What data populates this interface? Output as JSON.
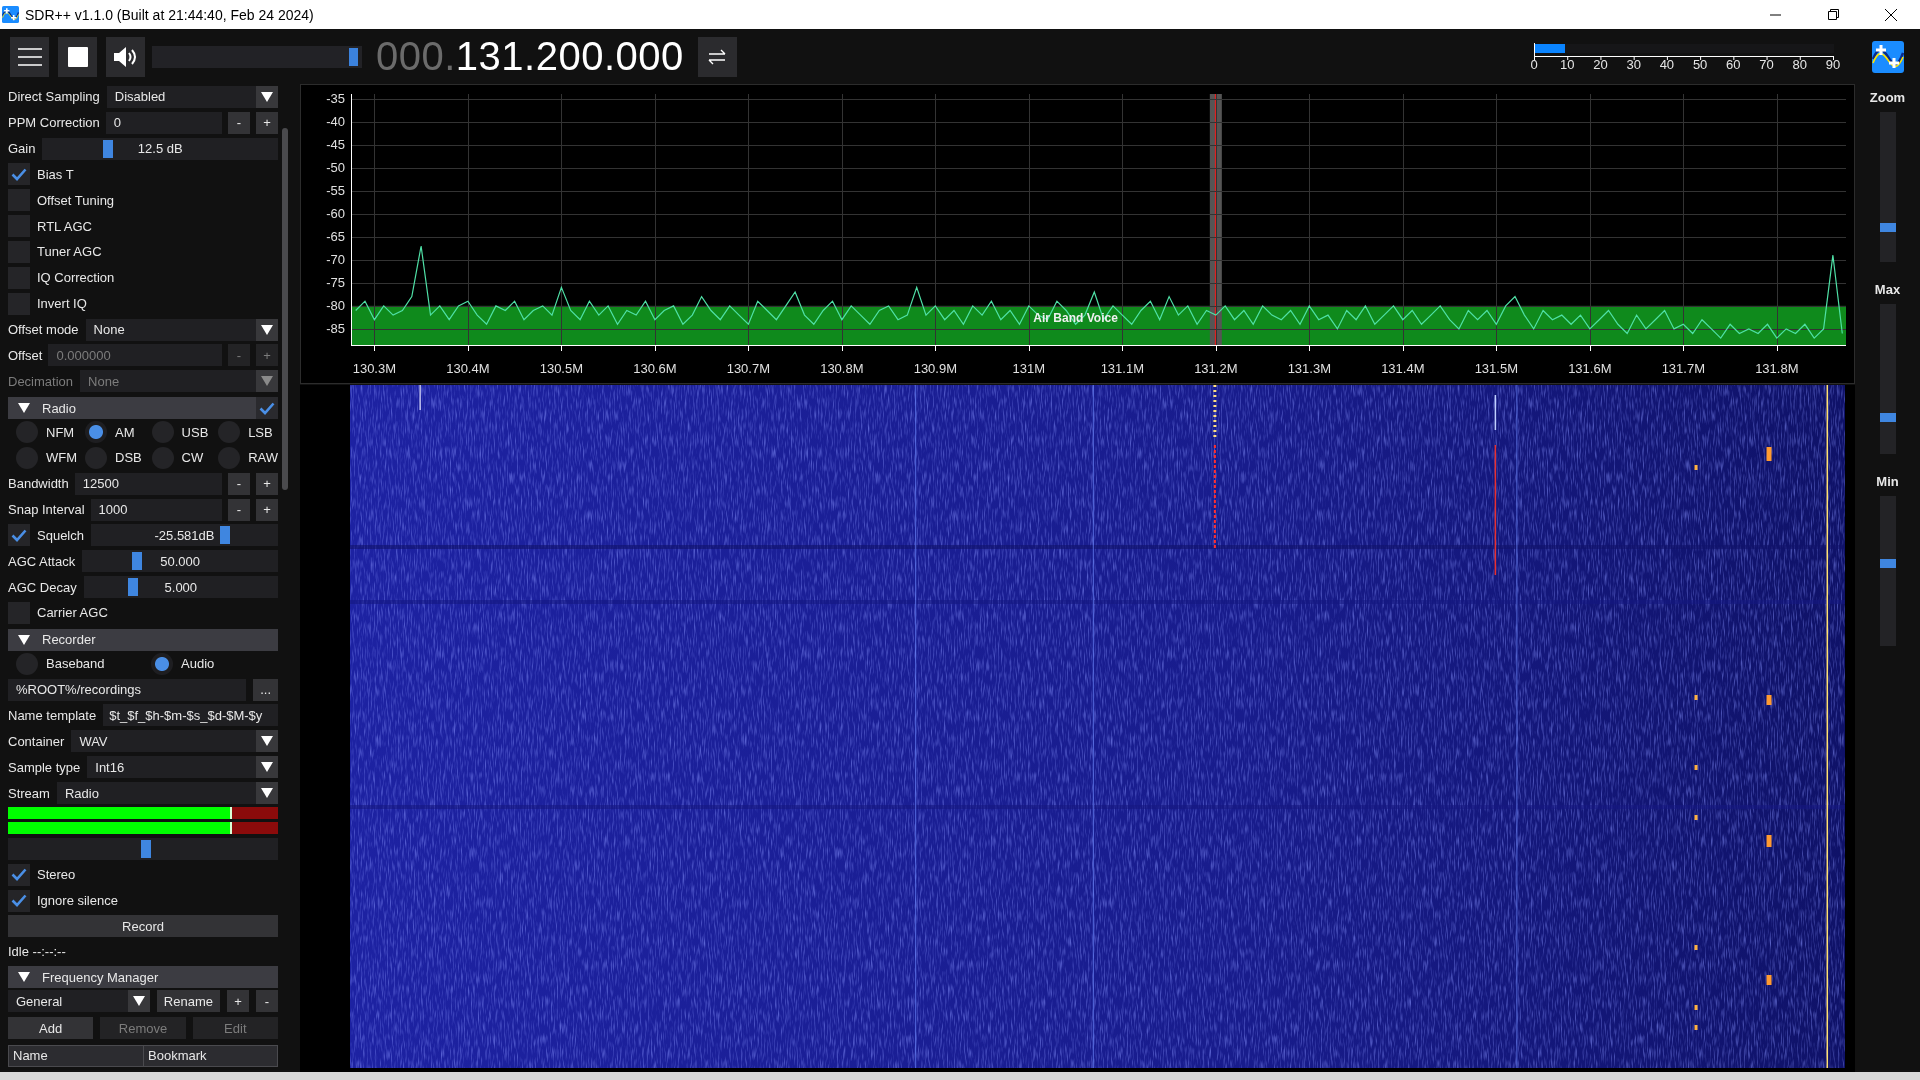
{
  "window": {
    "title": "SDR++ v1.1.0 (Built at 21:44:40, Feb 24 2024)"
  },
  "toolbar": {
    "playing": true,
    "volume": {
      "level": 0.98
    },
    "frequency": {
      "leading": "000.",
      "main": "131.200.000"
    },
    "snr_meter": {
      "level": 0.1,
      "ticks": [
        "0",
        "10",
        "20",
        "30",
        "40",
        "50",
        "60",
        "70",
        "80",
        "90"
      ]
    }
  },
  "sidebar": {
    "rows": [
      {
        "kind": "select",
        "label": "Direct Sampling",
        "value": "Disabled",
        "disabled": false
      },
      {
        "kind": "number",
        "label": "PPM Correction",
        "value": "0",
        "buttons": [
          "-",
          "+"
        ],
        "disabled": false
      },
      {
        "kind": "slider",
        "label": "Gain",
        "value": "12.5 dB",
        "level": 0.27
      },
      {
        "kind": "checkbox",
        "label": "Bias T",
        "checked": true
      },
      {
        "kind": "checkbox",
        "label": "Offset Tuning",
        "checked": false
      },
      {
        "kind": "checkbox",
        "label": "RTL AGC",
        "checked": false
      },
      {
        "kind": "checkbox",
        "label": "Tuner AGC",
        "checked": false
      },
      {
        "kind": "checkbox",
        "label": "IQ Correction",
        "checked": false
      },
      {
        "kind": "checkbox",
        "label": "Invert IQ",
        "checked": false
      },
      {
        "kind": "select",
        "label": "Offset mode",
        "value": "None",
        "disabled": false
      },
      {
        "kind": "number",
        "label": "Offset",
        "value": "0.000000",
        "buttons": [
          "-",
          "+"
        ],
        "disabled": true
      },
      {
        "kind": "select",
        "label": "Decimation",
        "value": "None",
        "disabled": true
      },
      {
        "kind": "header",
        "label": "Radio",
        "expanded": true,
        "checked": true
      },
      {
        "kind": "radios",
        "options": [
          {
            "label": "NFM",
            "selected": false
          },
          {
            "label": "AM",
            "selected": true
          },
          {
            "label": "USB",
            "selected": false
          },
          {
            "label": "LSB",
            "selected": false
          },
          {
            "label": "WFM",
            "selected": false
          },
          {
            "label": "DSB",
            "selected": false
          },
          {
            "label": "CW",
            "selected": false
          },
          {
            "label": "RAW",
            "selected": false
          }
        ]
      },
      {
        "kind": "number",
        "label": "Bandwidth",
        "value": "12500",
        "buttons": [
          "-",
          "+"
        ],
        "disabled": false
      },
      {
        "kind": "number",
        "label": "Snap Interval",
        "value": "1000",
        "buttons": [
          "-",
          "+"
        ],
        "disabled": false
      },
      {
        "kind": "checkbox_slider",
        "label": "Squelch",
        "checked": true,
        "value": "-25.581dB",
        "level": 0.73
      },
      {
        "kind": "slider",
        "label": "AGC Attack",
        "value": "50.000",
        "level": 0.27
      },
      {
        "kind": "slider",
        "label": "AGC Decay",
        "value": "5.000",
        "level": 0.24
      },
      {
        "kind": "checkbox",
        "label": "Carrier AGC",
        "checked": false
      },
      {
        "kind": "header",
        "label": "Recorder",
        "expanded": true
      },
      {
        "kind": "radios",
        "options": [
          {
            "label": "Baseband",
            "selected": false
          },
          {
            "label": "Audio",
            "selected": true
          }
        ]
      },
      {
        "kind": "path",
        "value": "%ROOT%/recordings",
        "button": "..."
      },
      {
        "kind": "text",
        "label": "Name template",
        "value": "$t_$f_$h-$m-$s_$d-$M-$y"
      },
      {
        "kind": "select",
        "label": "Container",
        "value": "WAV",
        "disabled": false
      },
      {
        "kind": "select",
        "label": "Sample type",
        "value": "Int16",
        "disabled": false
      },
      {
        "kind": "select",
        "label": "Stream",
        "value": "Radio",
        "disabled": false
      },
      {
        "kind": "meter",
        "level": 0.83
      },
      {
        "kind": "meter",
        "level": 0.83
      },
      {
        "kind": "slider",
        "level": 0.51
      },
      {
        "kind": "checkbox",
        "label": "Stereo",
        "checked": true
      },
      {
        "kind": "checkbox",
        "label": "Ignore silence",
        "checked": true
      },
      {
        "kind": "button",
        "label": "Record",
        "disabled": false
      },
      {
        "kind": "status",
        "text": "Idle --:--:--"
      },
      {
        "kind": "header",
        "label": "Frequency Manager",
        "expanded": true
      },
      {
        "kind": "combo_row",
        "value": "General",
        "buttons": [
          {
            "label": "Rename"
          },
          {
            "label": "+"
          },
          {
            "label": "-"
          }
        ]
      },
      {
        "kind": "buttons",
        "buttons": [
          {
            "label": "Add",
            "disabled": false
          },
          {
            "label": "Remove",
            "disabled": true
          },
          {
            "label": "Edit",
            "disabled": true
          }
        ]
      },
      {
        "kind": "table",
        "columns": [
          "Name",
          "Bookmark"
        ]
      }
    ]
  },
  "spectrum": {
    "bookmark": {
      "label": "Air Band Voice"
    },
    "chart_data": {
      "type": "line",
      "grid": true,
      "xlim": [
        130.275,
        131.874
      ],
      "ylim": [
        -88.5,
        -34
      ],
      "yticks": [
        -35,
        -40,
        -45,
        -50,
        -55,
        -60,
        -65,
        -70,
        -75,
        -80,
        -85
      ],
      "xticks": [
        {
          "value": 130.3,
          "label": "130.3M"
        },
        {
          "value": 130.4,
          "label": "130.4M"
        },
        {
          "value": 130.5,
          "label": "130.5M"
        },
        {
          "value": 130.6,
          "label": "130.6M"
        },
        {
          "value": 130.7,
          "label": "130.7M"
        },
        {
          "value": 130.8,
          "label": "130.8M"
        },
        {
          "value": 130.9,
          "label": "130.9M"
        },
        {
          "value": 131,
          "label": "131M"
        },
        {
          "value": 131.1,
          "label": "131.1M"
        },
        {
          "value": 131.2,
          "label": "131.2M"
        },
        {
          "value": 131.3,
          "label": "131.3M"
        },
        {
          "value": 131.4,
          "label": "131.4M"
        },
        {
          "value": 131.5,
          "label": "131.5M"
        },
        {
          "value": 131.6,
          "label": "131.6M"
        },
        {
          "value": 131.7,
          "label": "131.7M"
        },
        {
          "value": 131.8,
          "label": "131.8M"
        }
      ],
      "x": [
        130.28,
        130.29,
        130.3,
        130.31,
        130.32,
        130.33,
        130.34,
        130.35,
        130.36,
        130.37,
        130.38,
        130.39,
        130.4,
        130.41,
        130.42,
        130.43,
        130.44,
        130.45,
        130.46,
        130.47,
        130.48,
        130.49,
        130.5,
        130.51,
        130.52,
        130.53,
        130.54,
        130.55,
        130.56,
        130.57,
        130.58,
        130.59,
        130.6,
        130.61,
        130.62,
        130.63,
        130.64,
        130.65,
        130.66,
        130.67,
        130.68,
        130.69,
        130.7,
        130.71,
        130.72,
        130.73,
        130.74,
        130.75,
        130.76,
        130.77,
        130.78,
        130.79,
        130.8,
        130.81,
        130.82,
        130.83,
        130.84,
        130.85,
        130.86,
        130.87,
        130.88,
        130.89,
        130.9,
        130.91,
        130.92,
        130.93,
        130.94,
        130.95,
        130.96,
        130.97,
        130.98,
        130.99,
        131.0,
        131.01,
        131.02,
        131.03,
        131.04,
        131.05,
        131.06,
        131.07,
        131.08,
        131.09,
        131.1,
        131.11,
        131.12,
        131.13,
        131.14,
        131.15,
        131.16,
        131.17,
        131.18,
        131.19,
        131.2,
        131.21,
        131.22,
        131.23,
        131.24,
        131.25,
        131.26,
        131.27,
        131.28,
        131.29,
        131.3,
        131.31,
        131.32,
        131.33,
        131.34,
        131.35,
        131.36,
        131.37,
        131.38,
        131.39,
        131.4,
        131.41,
        131.42,
        131.43,
        131.44,
        131.45,
        131.46,
        131.47,
        131.48,
        131.49,
        131.5,
        131.51,
        131.52,
        131.53,
        131.54,
        131.55,
        131.56,
        131.57,
        131.58,
        131.59,
        131.6,
        131.61,
        131.62,
        131.63,
        131.64,
        131.65,
        131.66,
        131.67,
        131.68,
        131.69,
        131.7,
        131.71,
        131.72,
        131.73,
        131.74,
        131.75,
        131.76,
        131.77,
        131.78,
        131.79,
        131.8,
        131.81,
        131.82,
        131.83,
        131.84,
        131.85,
        131.86,
        131.87
      ],
      "series": [
        {
          "color": "#4fe0a6",
          "values": [
            -81,
            -79,
            -83,
            -80,
            -82,
            -81,
            -78,
            -67,
            -82,
            -80,
            -83,
            -80,
            -79,
            -82,
            -84,
            -80,
            -81,
            -79,
            -83,
            -81,
            -80,
            -82,
            -76,
            -81,
            -83,
            -79,
            -82,
            -80,
            -84,
            -81,
            -82,
            -79,
            -83,
            -81,
            -80,
            -84,
            -82,
            -78,
            -81,
            -83,
            -80,
            -82,
            -84,
            -79,
            -81,
            -83,
            -80,
            -77,
            -82,
            -84,
            -81,
            -79,
            -83,
            -80,
            -82,
            -84,
            -81,
            -80,
            -83,
            -82,
            -76,
            -82,
            -80,
            -83,
            -81,
            -84,
            -80,
            -82,
            -79,
            -83,
            -81,
            -84,
            -80,
            -82,
            -83,
            -79,
            -81,
            -84,
            -82,
            -77,
            -83,
            -80,
            -82,
            -84,
            -81,
            -79,
            -83,
            -78,
            -82,
            -80,
            -84,
            -81,
            -82,
            -80,
            -83,
            -81,
            -84,
            -80,
            -82,
            -83,
            -81,
            -84,
            -80,
            -83,
            -82,
            -85,
            -81,
            -83,
            -80,
            -84,
            -82,
            -80,
            -83,
            -81,
            -84,
            -82,
            -80,
            -83,
            -85,
            -81,
            -83,
            -81,
            -84,
            -80,
            -78,
            -82,
            -85,
            -81,
            -83,
            -82,
            -84,
            -82,
            -85,
            -83,
            -81,
            -84,
            -86,
            -82,
            -85,
            -83,
            -81,
            -85,
            -84,
            -86,
            -83,
            -85,
            -87,
            -84,
            -86,
            -85,
            -86,
            -84,
            -87,
            -85,
            -86,
            -84,
            -87,
            -85,
            -69,
            -86
          ]
        }
      ]
    }
  },
  "side_sliders": [
    {
      "label": "Zoom",
      "level": 0.21
    },
    {
      "label": "Max",
      "level": 0.23
    },
    {
      "label": "Min",
      "level": 0.55
    }
  ]
}
